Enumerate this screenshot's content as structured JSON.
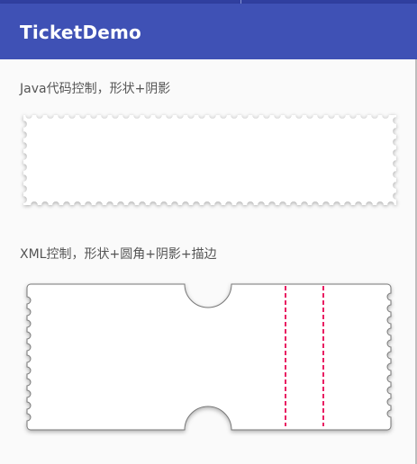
{
  "app": {
    "title": "TicketDemo"
  },
  "sections": [
    {
      "label": "Java代码控制，形状+阴影"
    },
    {
      "label": "XML控制，形状+圆角+阴影+描边"
    }
  ],
  "colors": {
    "status_bar": "#303f9f",
    "app_bar": "#3f51b5",
    "background": "#fafafa",
    "ticket_fill": "#ffffff",
    "ticket_stroke": "#777777",
    "perforation": "#e91e63"
  }
}
